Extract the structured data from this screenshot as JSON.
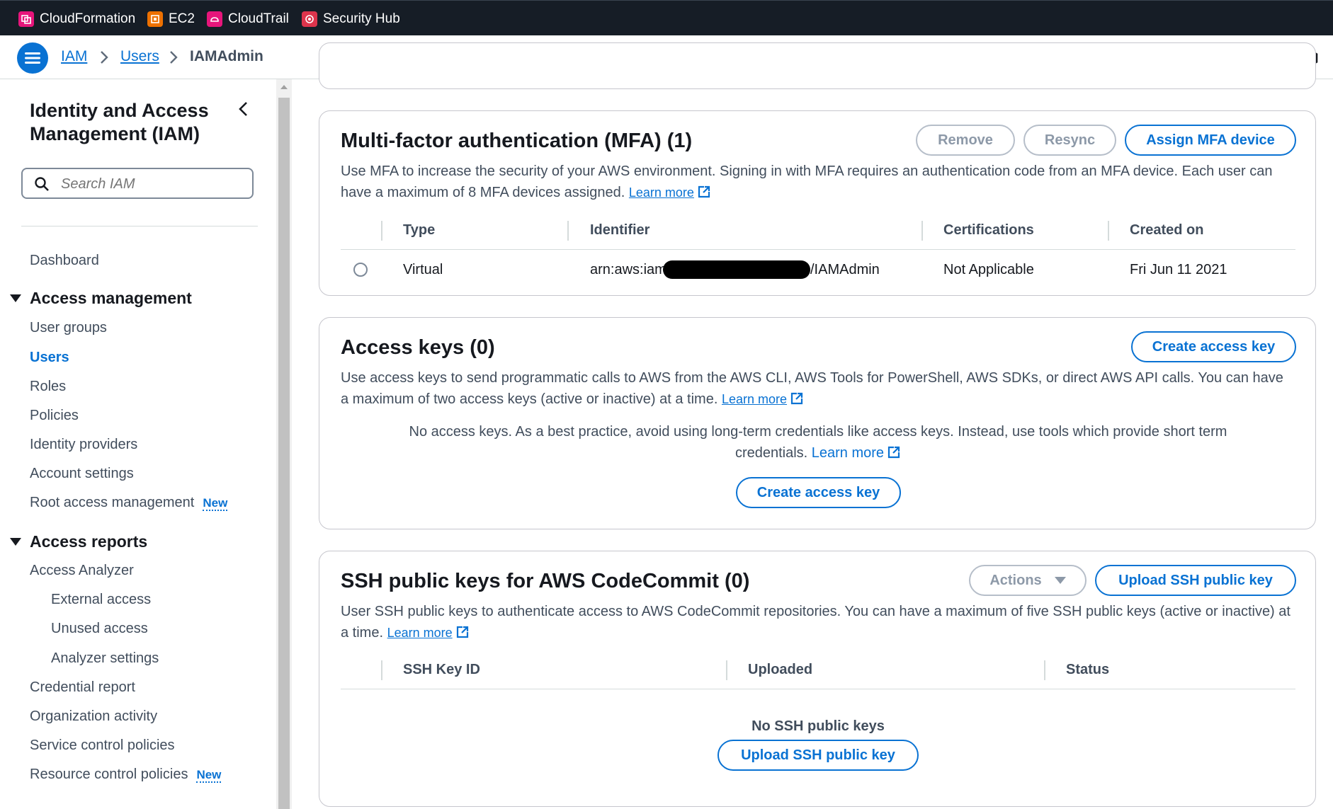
{
  "topbar": {
    "favorites": [
      {
        "label": "CloudFormation",
        "icon": "cloudformation-icon",
        "color": "#e7157b"
      },
      {
        "label": "EC2",
        "icon": "ec2-icon",
        "color": "#ed7100"
      },
      {
        "label": "CloudTrail",
        "icon": "cloudtrail-icon",
        "color": "#e7157b"
      },
      {
        "label": "Security Hub",
        "icon": "security-hub-icon",
        "color": "#dd344c"
      }
    ]
  },
  "breadcrumb": {
    "items": [
      "IAM",
      "Users",
      "IAMAdmin"
    ]
  },
  "sidebar": {
    "title_line1": "Identity and Access",
    "title_line2": "Management (IAM)",
    "search_placeholder": "Search IAM",
    "dashboard": "Dashboard",
    "access_management": {
      "label": "Access management",
      "items": [
        "User groups",
        "Users",
        "Roles",
        "Policies",
        "Identity providers",
        "Account settings",
        "Root access management"
      ],
      "active": "Users",
      "new_badge": "New"
    },
    "access_reports": {
      "label": "Access reports",
      "analyzer": "Access Analyzer",
      "analyzer_items": [
        "External access",
        "Unused access",
        "Analyzer settings"
      ],
      "items": [
        "Credential report",
        "Organization activity",
        "Service control policies",
        "Resource control policies"
      ],
      "new_badge": "New"
    }
  },
  "mfa": {
    "title": "Multi-factor authentication (MFA) (1)",
    "buttons": {
      "remove": "Remove",
      "resync": "Resync",
      "assign": "Assign MFA device"
    },
    "description": "Use MFA to increase the security of your AWS environment. Signing in with MFA requires an authentication code from an MFA device. Each user can have a maximum of 8 MFA devices assigned.",
    "learn_more": "Learn more",
    "columns": [
      "Type",
      "Identifier",
      "Certifications",
      "Created on"
    ],
    "rows": [
      {
        "type": "Virtual",
        "identifier_prefix": "arn:aws:iam",
        "identifier_suffix": "/IAMAdmin",
        "certifications": "Not Applicable",
        "created_on": "Fri Jun 11 2021"
      }
    ]
  },
  "access_keys": {
    "title": "Access keys (0)",
    "create_button": "Create access key",
    "description": "Use access keys to send programmatic calls to AWS from the AWS CLI, AWS Tools for PowerShell, AWS SDKs, or direct AWS API calls. You can have a maximum of two access keys (active or inactive) at a time.",
    "learn_more": "Learn more",
    "empty_text_line1": "No access keys. As a best practice, avoid using long-term credentials like access keys. Instead, use tools which provide short term",
    "empty_text_line2": "credentials.",
    "empty_learn_more": "Learn more",
    "empty_button": "Create access key"
  },
  "ssh": {
    "title": "SSH public keys for AWS CodeCommit (0)",
    "actions_button": "Actions",
    "upload_button": "Upload SSH public key",
    "description": "User SSH public keys to authenticate access to AWS CodeCommit repositories. You can have a maximum of five SSH public keys (active or inactive) at a time.",
    "learn_more": "Learn more",
    "columns": [
      "SSH Key ID",
      "Uploaded",
      "Status"
    ],
    "empty_text": "No SSH public keys",
    "empty_button": "Upload SSH public key"
  },
  "colors": {
    "accent": "#0972d3",
    "topbar": "#161d26",
    "text": "#16191f",
    "muted": "#414d5c"
  }
}
